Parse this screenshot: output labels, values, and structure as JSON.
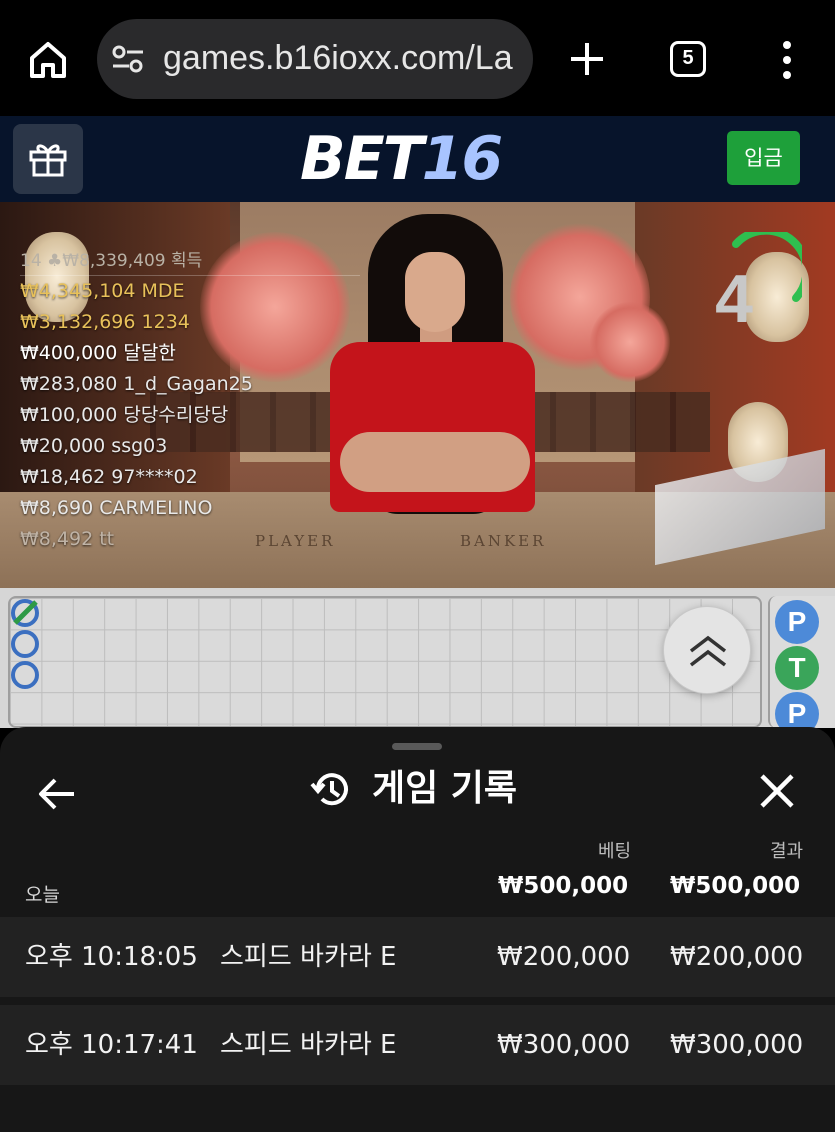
{
  "browser": {
    "url": "games.b16ioxx.com/La",
    "tab_count": "5"
  },
  "header": {
    "logo_part1": "BET",
    "logo_part2": "16",
    "deposit_label": "입금"
  },
  "video": {
    "countdown": "4",
    "top_winner": "14 ♣₩8,339,409 획득",
    "winners": [
      {
        "text": "₩4,345,104  MDE",
        "color": "#e8c15a"
      },
      {
        "text": "₩3,132,696  1234",
        "color": "#e8c15a"
      },
      {
        "text": "₩400,000  달달한",
        "color": "#ffffff"
      },
      {
        "text": "₩283,080  1_d_Gagan25",
        "color": "#e9e9e9"
      },
      {
        "text": "₩100,000  당당수리당당",
        "color": "#e9e9e9"
      },
      {
        "text": "₩20,000  ssg03",
        "color": "#e9e9e9"
      },
      {
        "text": "₩18,462  97****02",
        "color": "#e9e9e9"
      },
      {
        "text": "₩8,690  CARMELINO",
        "color": "#e9e9e9"
      },
      {
        "text": "₩8,492  tt",
        "color": "#bfb3a6"
      }
    ],
    "table_player": "PLAYER",
    "table_banker": "BANKER"
  },
  "roadmap": {
    "side": [
      {
        "label": "P",
        "color": "#4d8ad8"
      },
      {
        "label": "T",
        "color": "#3aa55a"
      },
      {
        "label": "P",
        "color": "#4d8ad8"
      }
    ]
  },
  "sheet": {
    "title": "게임 기록",
    "col_bet": "베팅",
    "col_result": "결과",
    "today_label": "오늘",
    "total_bet": "₩500,000",
    "total_result": "₩500,000",
    "rows": [
      {
        "time": "오후 10:18:05",
        "game": "스피드 바카라 E",
        "bet": "₩200,000",
        "result": "₩200,000"
      },
      {
        "time": "오후 10:17:41",
        "game": "스피드 바카라 E",
        "bet": "₩300,000",
        "result": "₩300,000"
      }
    ]
  },
  "icons": [
    "home-icon",
    "tune-icon",
    "plus-icon",
    "menu-icon",
    "gift-icon",
    "chevron-up-double-icon",
    "arrow-left-icon",
    "history-icon",
    "close-icon"
  ],
  "colors": {
    "header_bg": "#07142b",
    "deposit_green": "#1ea03a",
    "sheet_bg": "#171717",
    "row_bg": "#222222",
    "ring_blue": "#3b6fc0",
    "tie_green": "#2e9a46"
  }
}
